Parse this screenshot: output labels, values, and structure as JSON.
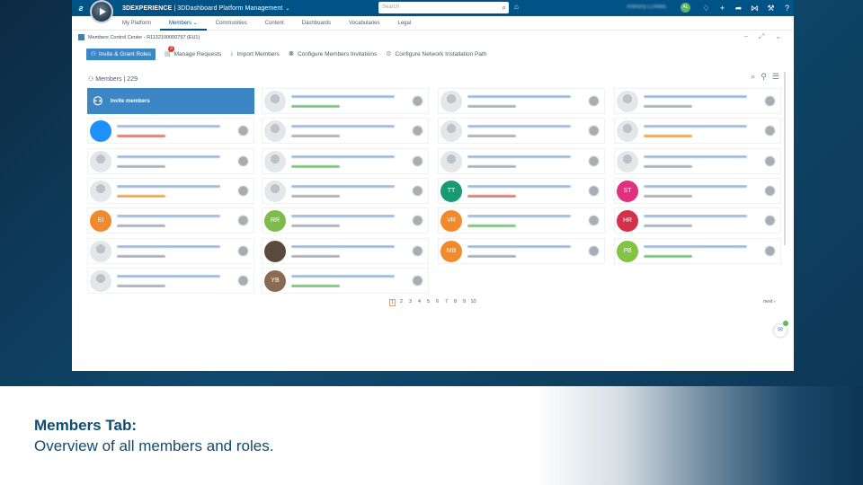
{
  "app": {
    "brand_bold": "3DEXPERIENCE",
    "brand_rest": " | 3DDashboard Platform Management",
    "search_placeholder": "Search",
    "user_name": "Anthony LOMBE",
    "user_initials": "AL"
  },
  "tabs": [
    {
      "label": "My Platform",
      "active": false
    },
    {
      "label": "Members",
      "active": true
    },
    {
      "label": "Communities",
      "active": false
    },
    {
      "label": "Content",
      "active": false
    },
    {
      "label": "Dashboards",
      "active": false
    },
    {
      "label": "Vocabularies",
      "active": false
    },
    {
      "label": "Legal",
      "active": false
    }
  ],
  "panel": {
    "title": "Members Control Center - R1132100000797 (EU1)"
  },
  "toolbar": {
    "invite_grant": "Invite & Grant Roles",
    "manage_requests": "Manage Requests",
    "manage_requests_badge": "3",
    "import_members": "Import Members",
    "configure_invitations": "Configure Members Invitations",
    "configure_network": "Configure Network Installation Path"
  },
  "members": {
    "label": "Members",
    "separator": "|",
    "count": "229",
    "invite_label": "Invite members"
  },
  "cards": [
    {
      "col": 0,
      "row": 1,
      "avatar": "blue",
      "role": "red"
    },
    {
      "col": 0,
      "row": 2,
      "avatar": "gray",
      "role": "gray"
    },
    {
      "col": 0,
      "row": 3,
      "avatar": "gray",
      "role": "orange"
    },
    {
      "col": 0,
      "row": 4,
      "avatar": "orange",
      "initials": "EI",
      "role": "gray"
    },
    {
      "col": 0,
      "row": 5,
      "avatar": "gray",
      "role": "gray"
    },
    {
      "col": 0,
      "row": 6,
      "avatar": "gray",
      "role": "gray"
    },
    {
      "col": 1,
      "row": 0,
      "avatar": "gray",
      "role": "green"
    },
    {
      "col": 1,
      "row": 1,
      "avatar": "gray",
      "role": "gray"
    },
    {
      "col": 1,
      "row": 2,
      "avatar": "gray",
      "role": "green"
    },
    {
      "col": 1,
      "row": 3,
      "avatar": "gray",
      "role": "gray"
    },
    {
      "col": 1,
      "row": 4,
      "avatar": "green",
      "initials": "RR",
      "role": "gray"
    },
    {
      "col": 1,
      "row": 5,
      "avatar": "photo",
      "role": "gray"
    },
    {
      "col": 1,
      "row": 6,
      "avatar": "brown",
      "initials": "YB",
      "role": "green"
    },
    {
      "col": 2,
      "row": 0,
      "avatar": "gray",
      "role": "gray"
    },
    {
      "col": 2,
      "row": 1,
      "avatar": "gray",
      "role": "gray"
    },
    {
      "col": 2,
      "row": 2,
      "avatar": "gray",
      "role": "gray"
    },
    {
      "col": 2,
      "row": 3,
      "avatar": "teal",
      "initials": "TT",
      "role": "red"
    },
    {
      "col": 2,
      "row": 4,
      "avatar": "orange",
      "initials": "VR",
      "role": "green"
    },
    {
      "col": 2,
      "row": 5,
      "avatar": "orange",
      "initials": "MB",
      "role": "gray"
    },
    {
      "col": 3,
      "row": 0,
      "avatar": "gray",
      "role": "gray"
    },
    {
      "col": 3,
      "row": 1,
      "avatar": "gray",
      "role": "orange"
    },
    {
      "col": 3,
      "row": 2,
      "avatar": "gray",
      "role": "gray"
    },
    {
      "col": 3,
      "row": 3,
      "avatar": "pink",
      "initials": "ST",
      "role": "gray"
    },
    {
      "col": 3,
      "row": 4,
      "avatar": "crimson",
      "initials": "HR",
      "role": "gray"
    },
    {
      "col": 3,
      "row": 5,
      "avatar": "lime",
      "initials": "PB",
      "role": "green"
    }
  ],
  "pagination": {
    "pages": [
      "1",
      "2",
      "3",
      "4",
      "5",
      "6",
      "7",
      "8",
      "9",
      "10"
    ],
    "current": "1",
    "next": "next ›"
  },
  "caption": {
    "title": "Members Tab:",
    "subtitle": "Overview of all members and roles."
  },
  "colors": {
    "topbar": "#005386",
    "accent": "#3b86c7",
    "avatar_blue": "#1e90ff",
    "avatar_orange": "#f08a2c",
    "avatar_green": "#7dbb4a",
    "avatar_teal": "#1a9a72",
    "avatar_pink": "#e0307e",
    "avatar_crimson": "#d5304a",
    "avatar_lime": "#82c341",
    "avatar_brown": "#8a6b52",
    "avatar_photo": "#5a4a3e"
  },
  "icons": [
    "ds-logo-icon",
    "compass-icon",
    "search-icon",
    "tag-icon",
    "notification-icon",
    "add-icon",
    "share-icon",
    "network-icon",
    "tools-icon",
    "help-icon"
  ]
}
